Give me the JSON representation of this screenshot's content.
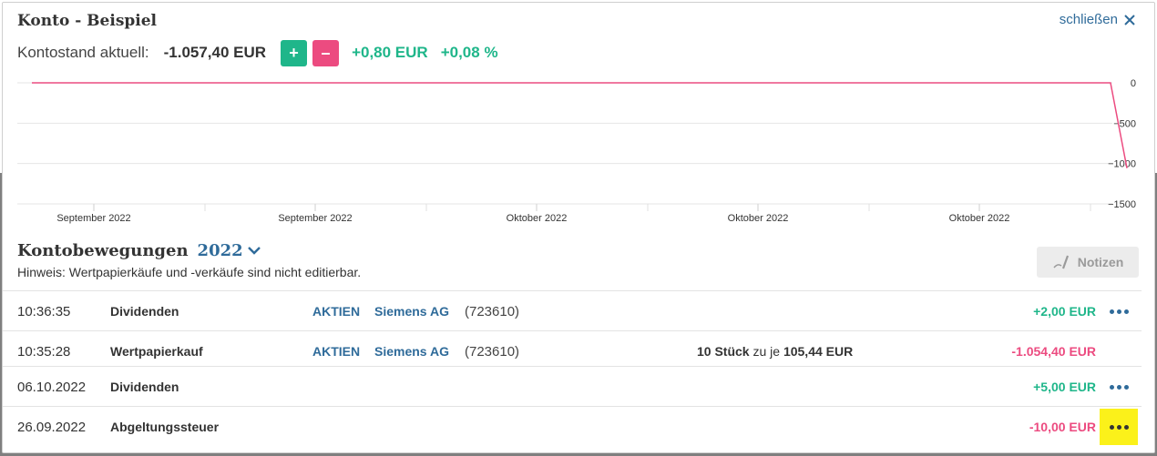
{
  "modal": {
    "title": "Konto - Beispiel",
    "close_label": "schließen"
  },
  "balance": {
    "label": "Kontostand aktuell:",
    "value": "-1.057,40 EUR",
    "plus_label": "+",
    "minus_label": "–",
    "change_abs": "+0,80 EUR",
    "change_pct": "+0,08 %"
  },
  "colors": {
    "accent_green": "#1fb68a",
    "accent_pink": "#ec4b80",
    "link_blue": "#2f6b9a",
    "highlight": "#fbf11a"
  },
  "chart_data": {
    "type": "line",
    "x_ticks": [
      "September 2022",
      "September 2022",
      "Oktober 2022",
      "Oktober 2022",
      "Oktober 2022"
    ],
    "y_ticks": [
      "0",
      "−500",
      "−1000",
      "−1500"
    ],
    "ylim": [
      -1500,
      0
    ],
    "grid": true,
    "series": [
      {
        "x": [
          0,
          0.985,
          1.0
        ],
        "values": [
          0,
          0,
          -1057.4
        ]
      }
    ]
  },
  "movements": {
    "title": "Kontobewegungen",
    "year": "2022",
    "hint": "Hinweis: Wertpapierkäufe und -verkäufe sind nicht editierbar.",
    "notes_label": "Notizen",
    "rows": [
      {
        "time": "10:36:35",
        "type": "Dividenden",
        "category": "AKTIEN",
        "security": "Siemens AG",
        "wkn": "(723610)",
        "qty": "",
        "qty_mid": "",
        "price": "",
        "amount": "+2,00 EUR",
        "sign": "pos",
        "menu": "dots-blue"
      },
      {
        "time": "10:35:28",
        "type": "Wertpapierkauf",
        "category": "AKTIEN",
        "security": "Siemens AG",
        "wkn": "(723610)",
        "qty": "10 Stück",
        "qty_mid": " zu je ",
        "price": "105,44 EUR",
        "amount": "-1.054,40 EUR",
        "sign": "neg",
        "menu": "none"
      },
      {
        "time": "06.10.2022",
        "type": "Dividenden",
        "category": "",
        "security": "",
        "wkn": "",
        "qty": "",
        "qty_mid": "",
        "price": "",
        "amount": "+5,00 EUR",
        "sign": "pos",
        "menu": "dots-blue"
      },
      {
        "time": "26.09.2022",
        "type": "Abgeltungssteuer",
        "category": "",
        "security": "",
        "wkn": "",
        "qty": "",
        "qty_mid": "",
        "price": "",
        "amount": "-10,00 EUR",
        "sign": "neg",
        "menu": "dots-highlighted"
      }
    ]
  }
}
